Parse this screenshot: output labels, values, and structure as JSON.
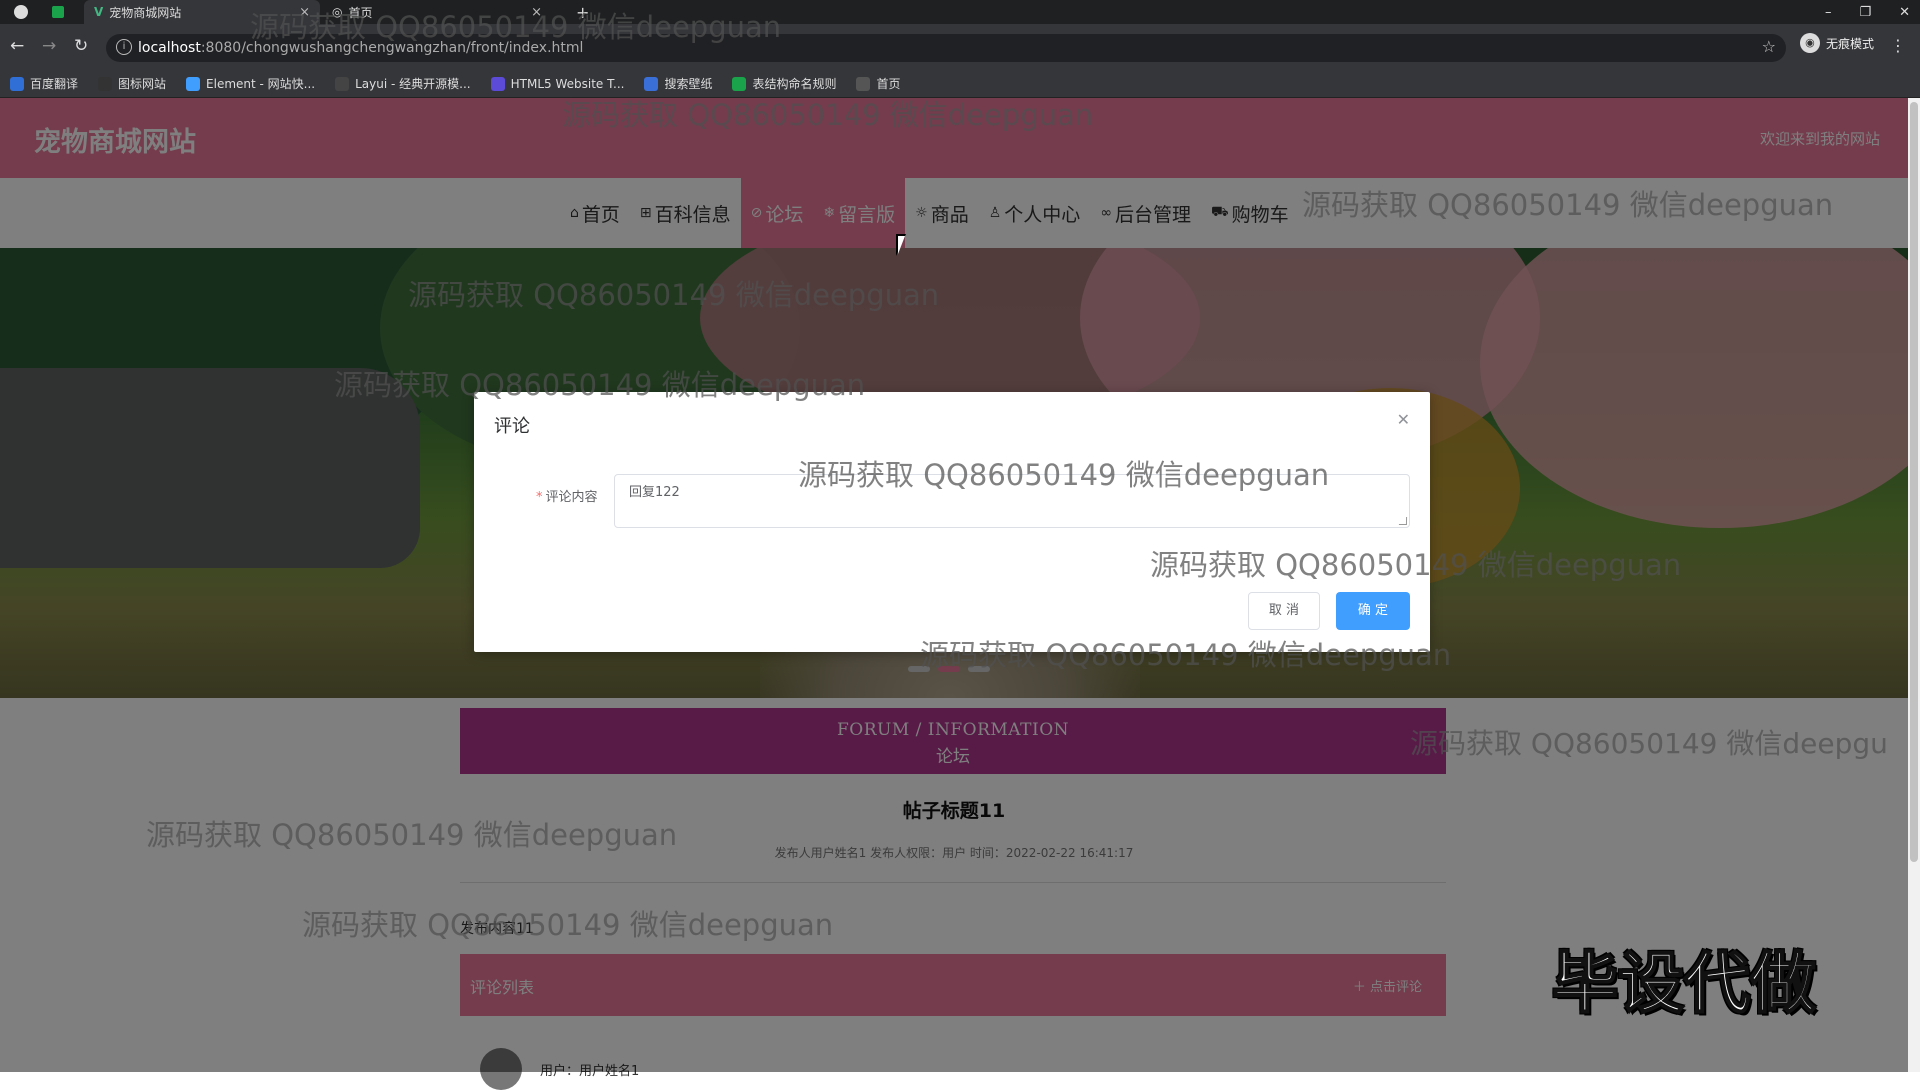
{
  "browser": {
    "tabs": [
      {
        "label": ""
      },
      {
        "label": ""
      },
      {
        "label": "宠物商城网站"
      },
      {
        "label": "首页"
      }
    ],
    "url_host": "localhost",
    "url_path": ":8080/chongwushangchengwangzhan/front/index.html",
    "incognito_label": "无痕模式",
    "bookmarks": [
      {
        "label": "百度翻译",
        "color": "#2f6fd6"
      },
      {
        "label": "图标网站",
        "color": "#333333"
      },
      {
        "label": "Element - 网站快...",
        "color": "#409eff"
      },
      {
        "label": "Layui - 经典开源模...",
        "color": "#444444"
      },
      {
        "label": "HTML5 Website T...",
        "color": "#5b4bd6"
      },
      {
        "label": "搜索壁纸",
        "color": "#3a6fd8"
      },
      {
        "label": "表结构命名规则",
        "color": "#1aa34a"
      },
      {
        "label": "首页",
        "color": "#555555"
      }
    ]
  },
  "site": {
    "title": "宠物商城网站",
    "welcome": "欢迎来到我的网站",
    "brand_color": "#e8799b",
    "nav": [
      {
        "label": "首页",
        "icon": "home-icon",
        "glyph": "⌂",
        "active": false
      },
      {
        "label": "百科信息",
        "icon": "grid-icon",
        "glyph": "⊞",
        "active": false
      },
      {
        "label": "论坛",
        "icon": "tag-icon",
        "glyph": "⊘",
        "active": true
      },
      {
        "label": "留言版",
        "icon": "snowflake-icon",
        "glyph": "❄",
        "active": true
      },
      {
        "label": "商品",
        "icon": "gear-icon",
        "glyph": "☼",
        "active": false
      },
      {
        "label": "个人中心",
        "icon": "user-icon",
        "glyph": "♙",
        "active": false
      },
      {
        "label": "后台管理",
        "icon": "link-icon",
        "glyph": "∞",
        "active": false
      },
      {
        "label": "购物车",
        "icon": "cart-icon",
        "glyph": "⛟",
        "active": false
      }
    ]
  },
  "forum": {
    "heading_en": "FORUM / INFORMATION",
    "heading_cn": "论坛",
    "post_title": "帖子标题11",
    "post_meta": "发布人用户姓名1   发布人权限：用户   时间：2022-02-22 16:41:17",
    "post_body": "发布内容11",
    "comment_list_title": "评论列表",
    "comment_add": "点击评论",
    "comment_user": "用户：用户姓名1"
  },
  "dialog": {
    "title": "评论",
    "field_label": "评论内容",
    "field_value": "回复122",
    "cancel": "取 消",
    "confirm": "确 定",
    "confirm_color": "#409eff"
  },
  "overlay": {
    "watermark": "源码获取 QQ86050149 微信deepguan",
    "stamp": "毕设代做"
  }
}
